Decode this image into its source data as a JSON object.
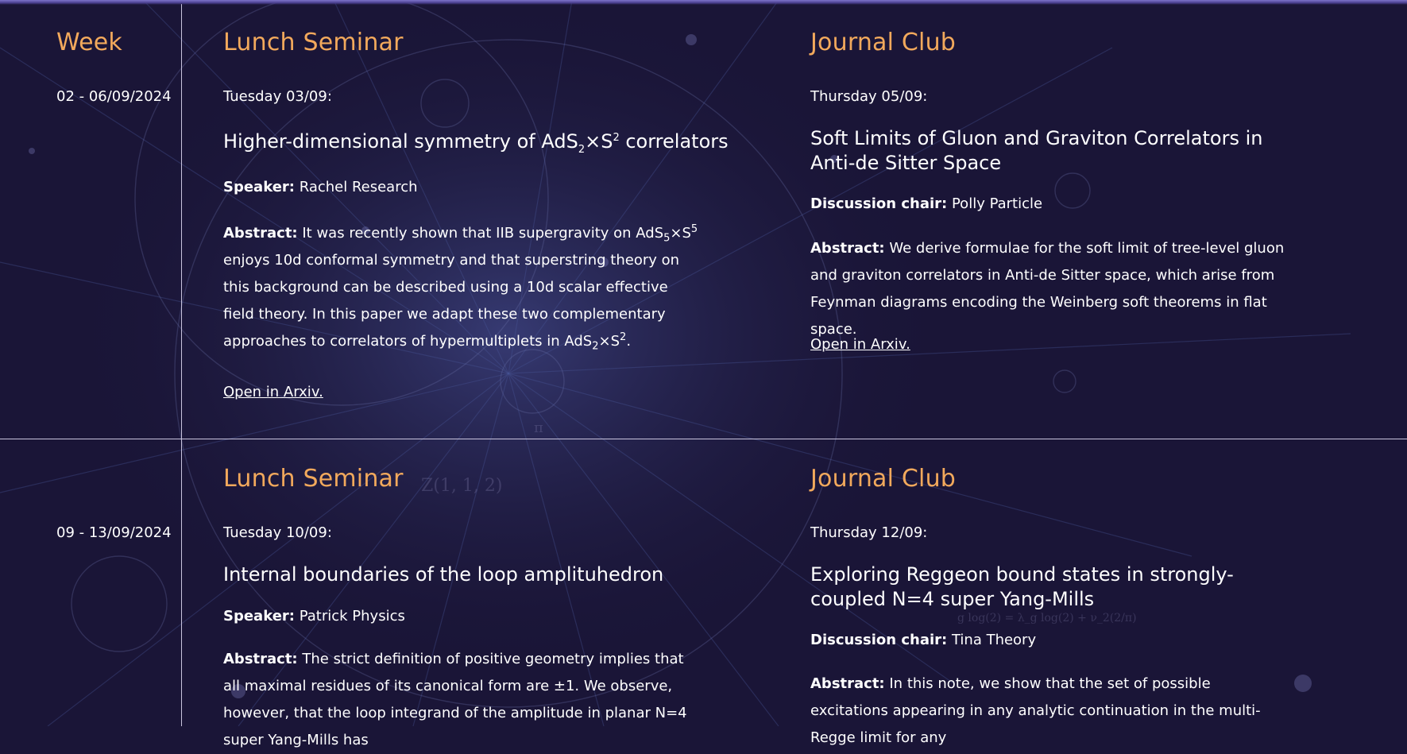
{
  "colors": {
    "background": "#1a1537",
    "accent": "#f2a95c",
    "divider": "#c9c4de",
    "text": "#ffffff"
  },
  "header": {
    "week_label": "Week"
  },
  "weeks": [
    {
      "range": "02 - 06/09/2024",
      "lunch": {
        "heading": "Lunch Seminar",
        "date": "Tuesday 03/09:",
        "title_pre": "Higher-dimensional symmetry of AdS",
        "title_sub": "2",
        "title_mid": "×S",
        "title_sup": "2",
        "title_post": " correlators",
        "speaker_label": "Speaker:",
        "speaker": "Rachel Research",
        "abstract_label": "Abstract:",
        "abstract_p1": "It was recently shown that IIB supergravity on AdS",
        "abstract_sub1": "5",
        "abstract_p2": "×S",
        "abstract_sup1": "5",
        "abstract_p3": " enjoys 10d conformal symmetry and that superstring theory on this background can be described using a 10d scalar effective field theory. In this paper we adapt these two complementary approaches to correlators of hypermultiplets in AdS",
        "abstract_sub2": "2",
        "abstract_p4": "×S",
        "abstract_sup2": "2",
        "abstract_p5": ".",
        "link": "Open in Arxiv."
      },
      "journal": {
        "heading": "Journal Club",
        "date": "Thursday 05/09:",
        "title": "Soft Limits of Gluon and Graviton Correlators in Anti-de Sitter Space",
        "chair_label": "Discussion chair:",
        "chair": "Polly Particle",
        "abstract_label": "Abstract:",
        "abstract": "We derive formulae for the soft limit of tree-level gluon and graviton correlators in Anti-de Sitter space, which arise from Feynman diagrams encoding the Weinberg soft theorems in flat space.",
        "link": "Open in Arxiv."
      }
    },
    {
      "range": "09 - 13/09/2024",
      "lunch": {
        "heading": "Lunch Seminar",
        "date": "Tuesday 10/09:",
        "title": "Internal boundaries of the loop amplituhedron",
        "speaker_label": "Speaker:",
        "speaker": "Patrick Physics",
        "abstract_label": "Abstract:",
        "abstract": "The strict definition of positive geometry implies that all maximal residues of its canonical form are ±1. We observe, however, that the loop integrand of the amplitude in planar N=4 super Yang-Mills has"
      },
      "journal": {
        "heading": "Journal Club",
        "date": "Thursday 12/09:",
        "title": "Exploring Reggeon bound states in strongly-coupled N=4 super Yang-Mills",
        "chair_label": "Discussion chair:",
        "chair": "Tina Theory",
        "abstract_label": "Abstract:",
        "abstract": "In this note, we show that the set of possible excitations appearing in any analytic continuation in the multi-Regge limit for any"
      }
    }
  ],
  "background_text": {
    "z_label": "Z(1, 1, 2)",
    "pi_label": "π",
    "formula": "g log(2) = λ_g log(2) + ν_2(2/π)"
  }
}
